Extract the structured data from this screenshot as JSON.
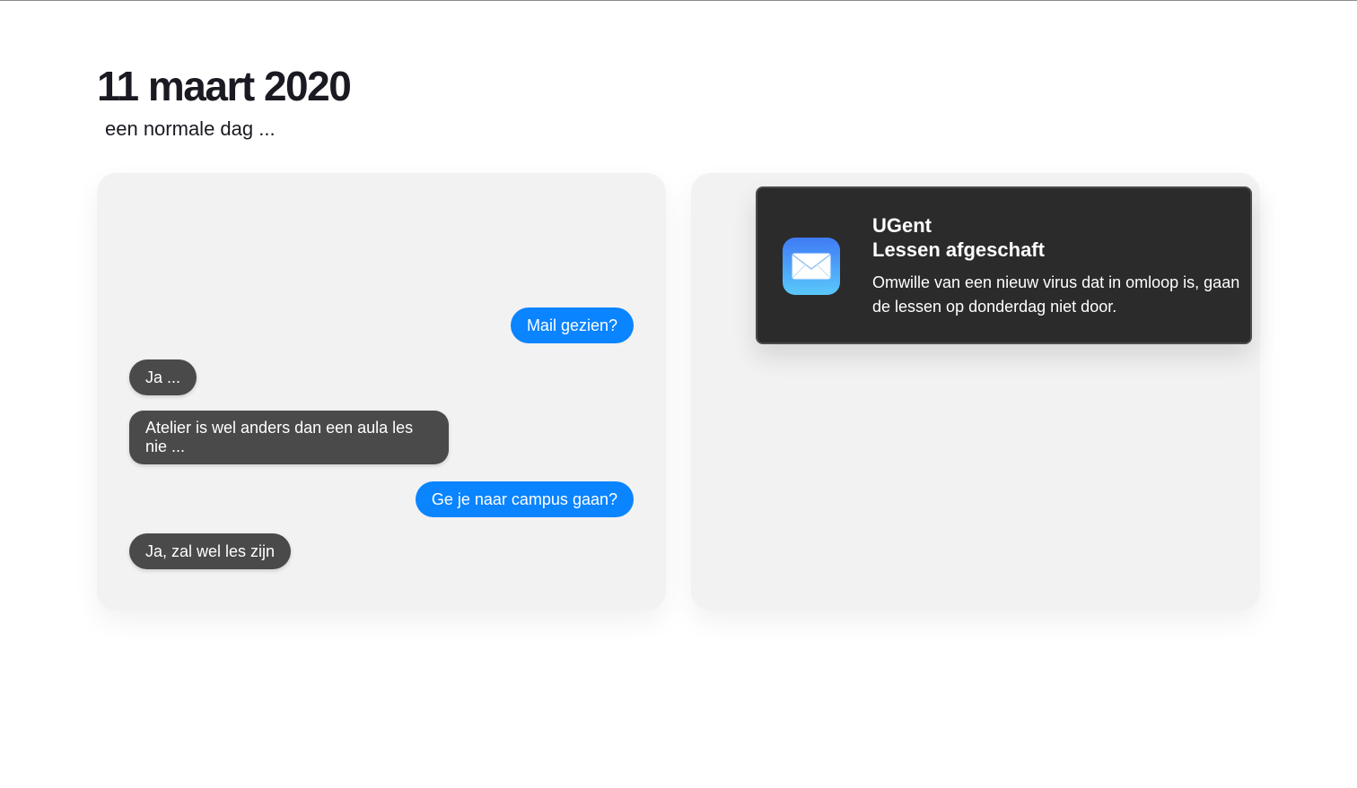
{
  "header": {
    "title": "11 maart 2020",
    "subtitle": "een normale dag ..."
  },
  "chat": {
    "messages": [
      {
        "from": "sent",
        "text": "Mail gezien?"
      },
      {
        "from": "received",
        "text": "Ja ..."
      },
      {
        "from": "received",
        "text": "Atelier is wel anders dan een aula les nie ..."
      },
      {
        "from": "sent",
        "text": "Ge je naar campus gaan?"
      },
      {
        "from": "received",
        "text": "Ja, zal wel les zijn"
      }
    ]
  },
  "notification": {
    "icon": "mail-icon",
    "sender": "UGent",
    "subject": "Lessen afgeschaft",
    "body": "Omwille van een nieuw virus dat in omloop is, gaan de lessen op donderdag niet door."
  },
  "colors": {
    "sent_bubble": "#0a84ff",
    "received_bubble": "#4a4a4a",
    "panel_background": "#f2f2f2",
    "notification_background": "#2b2b2b"
  }
}
